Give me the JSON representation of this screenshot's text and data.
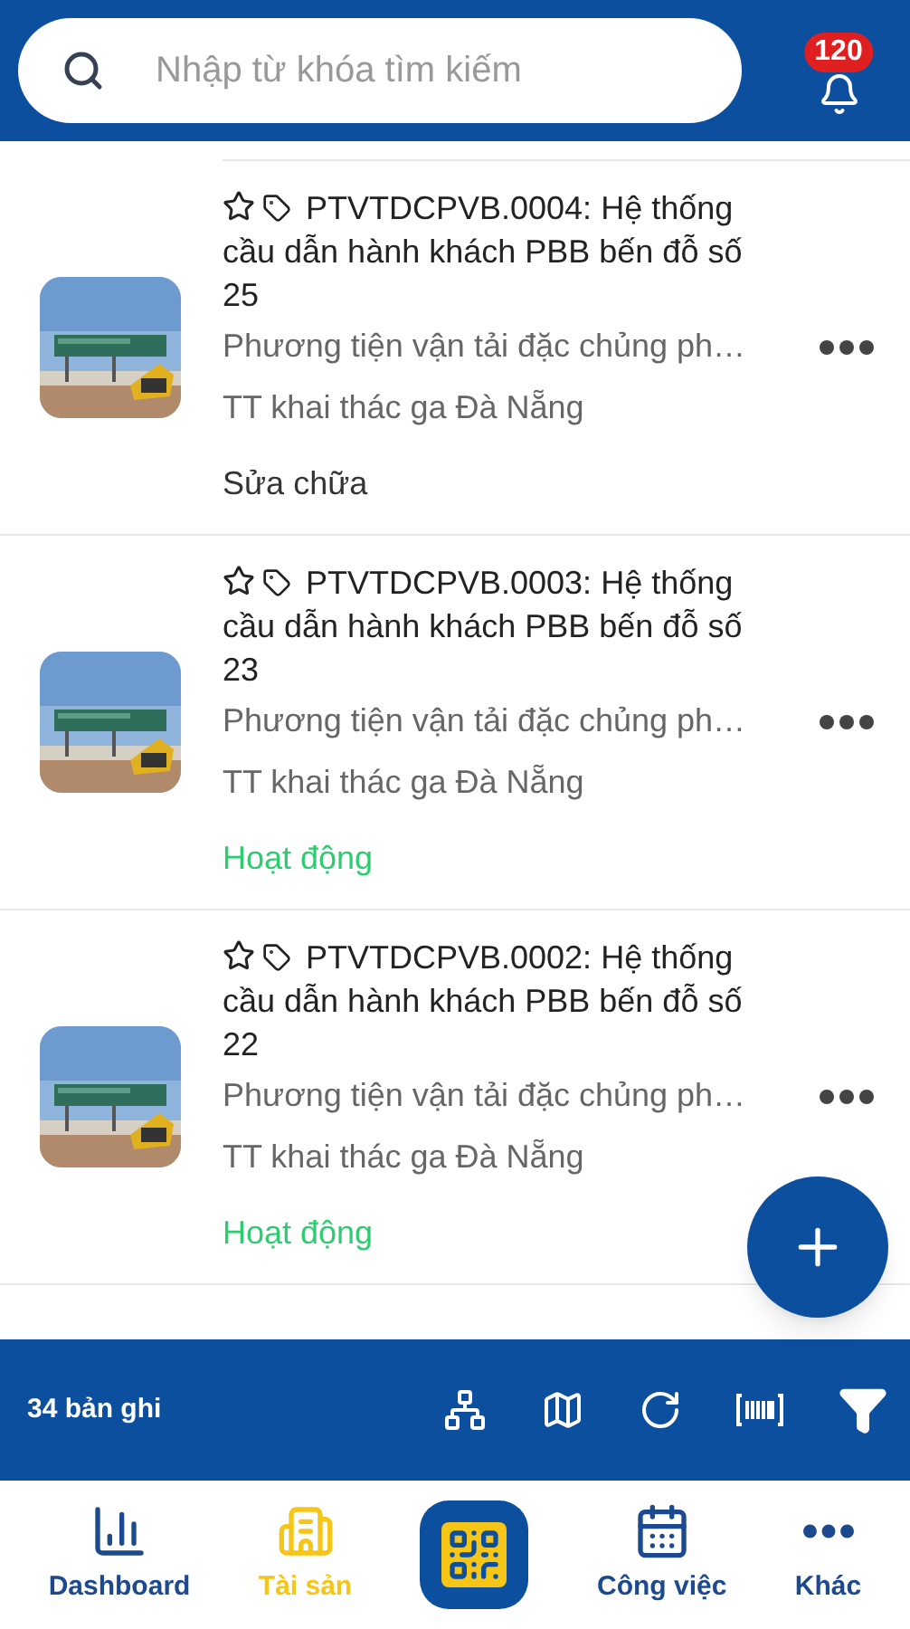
{
  "search": {
    "placeholder": "Nhập từ khóa tìm kiếm"
  },
  "notifications": {
    "count": "120"
  },
  "items": [
    {
      "title": "PTVTDCPVB.0004: Hệ thống cầu dẫn hành khách PBB bến đỗ số 25",
      "category": "Phương tiện vận tải đặc chủng ph…",
      "unit": "TT khai thác ga Đà Nẵng",
      "status": {
        "text": "Sửa chữa",
        "color": "#333333"
      }
    },
    {
      "title": "PTVTDCPVB.0003: Hệ thống cầu dẫn hành khách PBB bến đỗ số 23",
      "category": "Phương tiện vận tải đặc chủng ph…",
      "unit": "TT khai thác ga Đà Nẵng",
      "status": {
        "text": "Hoạt động",
        "color": "#2ecc71"
      }
    },
    {
      "title": "PTVTDCPVB.0002: Hệ thống cầu dẫn hành khách PBB bến đỗ số 22",
      "category": "Phương tiện vận tải đặc chủng ph…",
      "unit": "TT khai thác ga Đà Nẵng",
      "status": {
        "text": "Hoạt động",
        "color": "#2ecc71"
      }
    }
  ],
  "toolbar": {
    "record_count": "34 bản ghi"
  },
  "nav": [
    {
      "kind": "chart",
      "label": "Dashboard",
      "selected": false
    },
    {
      "kind": "building",
      "label": "Tài sản",
      "selected": true
    },
    {
      "kind": "qr"
    },
    {
      "kind": "calendar",
      "label": "Công việc",
      "selected": false
    },
    {
      "kind": "more",
      "label": "Khác",
      "selected": false
    }
  ]
}
